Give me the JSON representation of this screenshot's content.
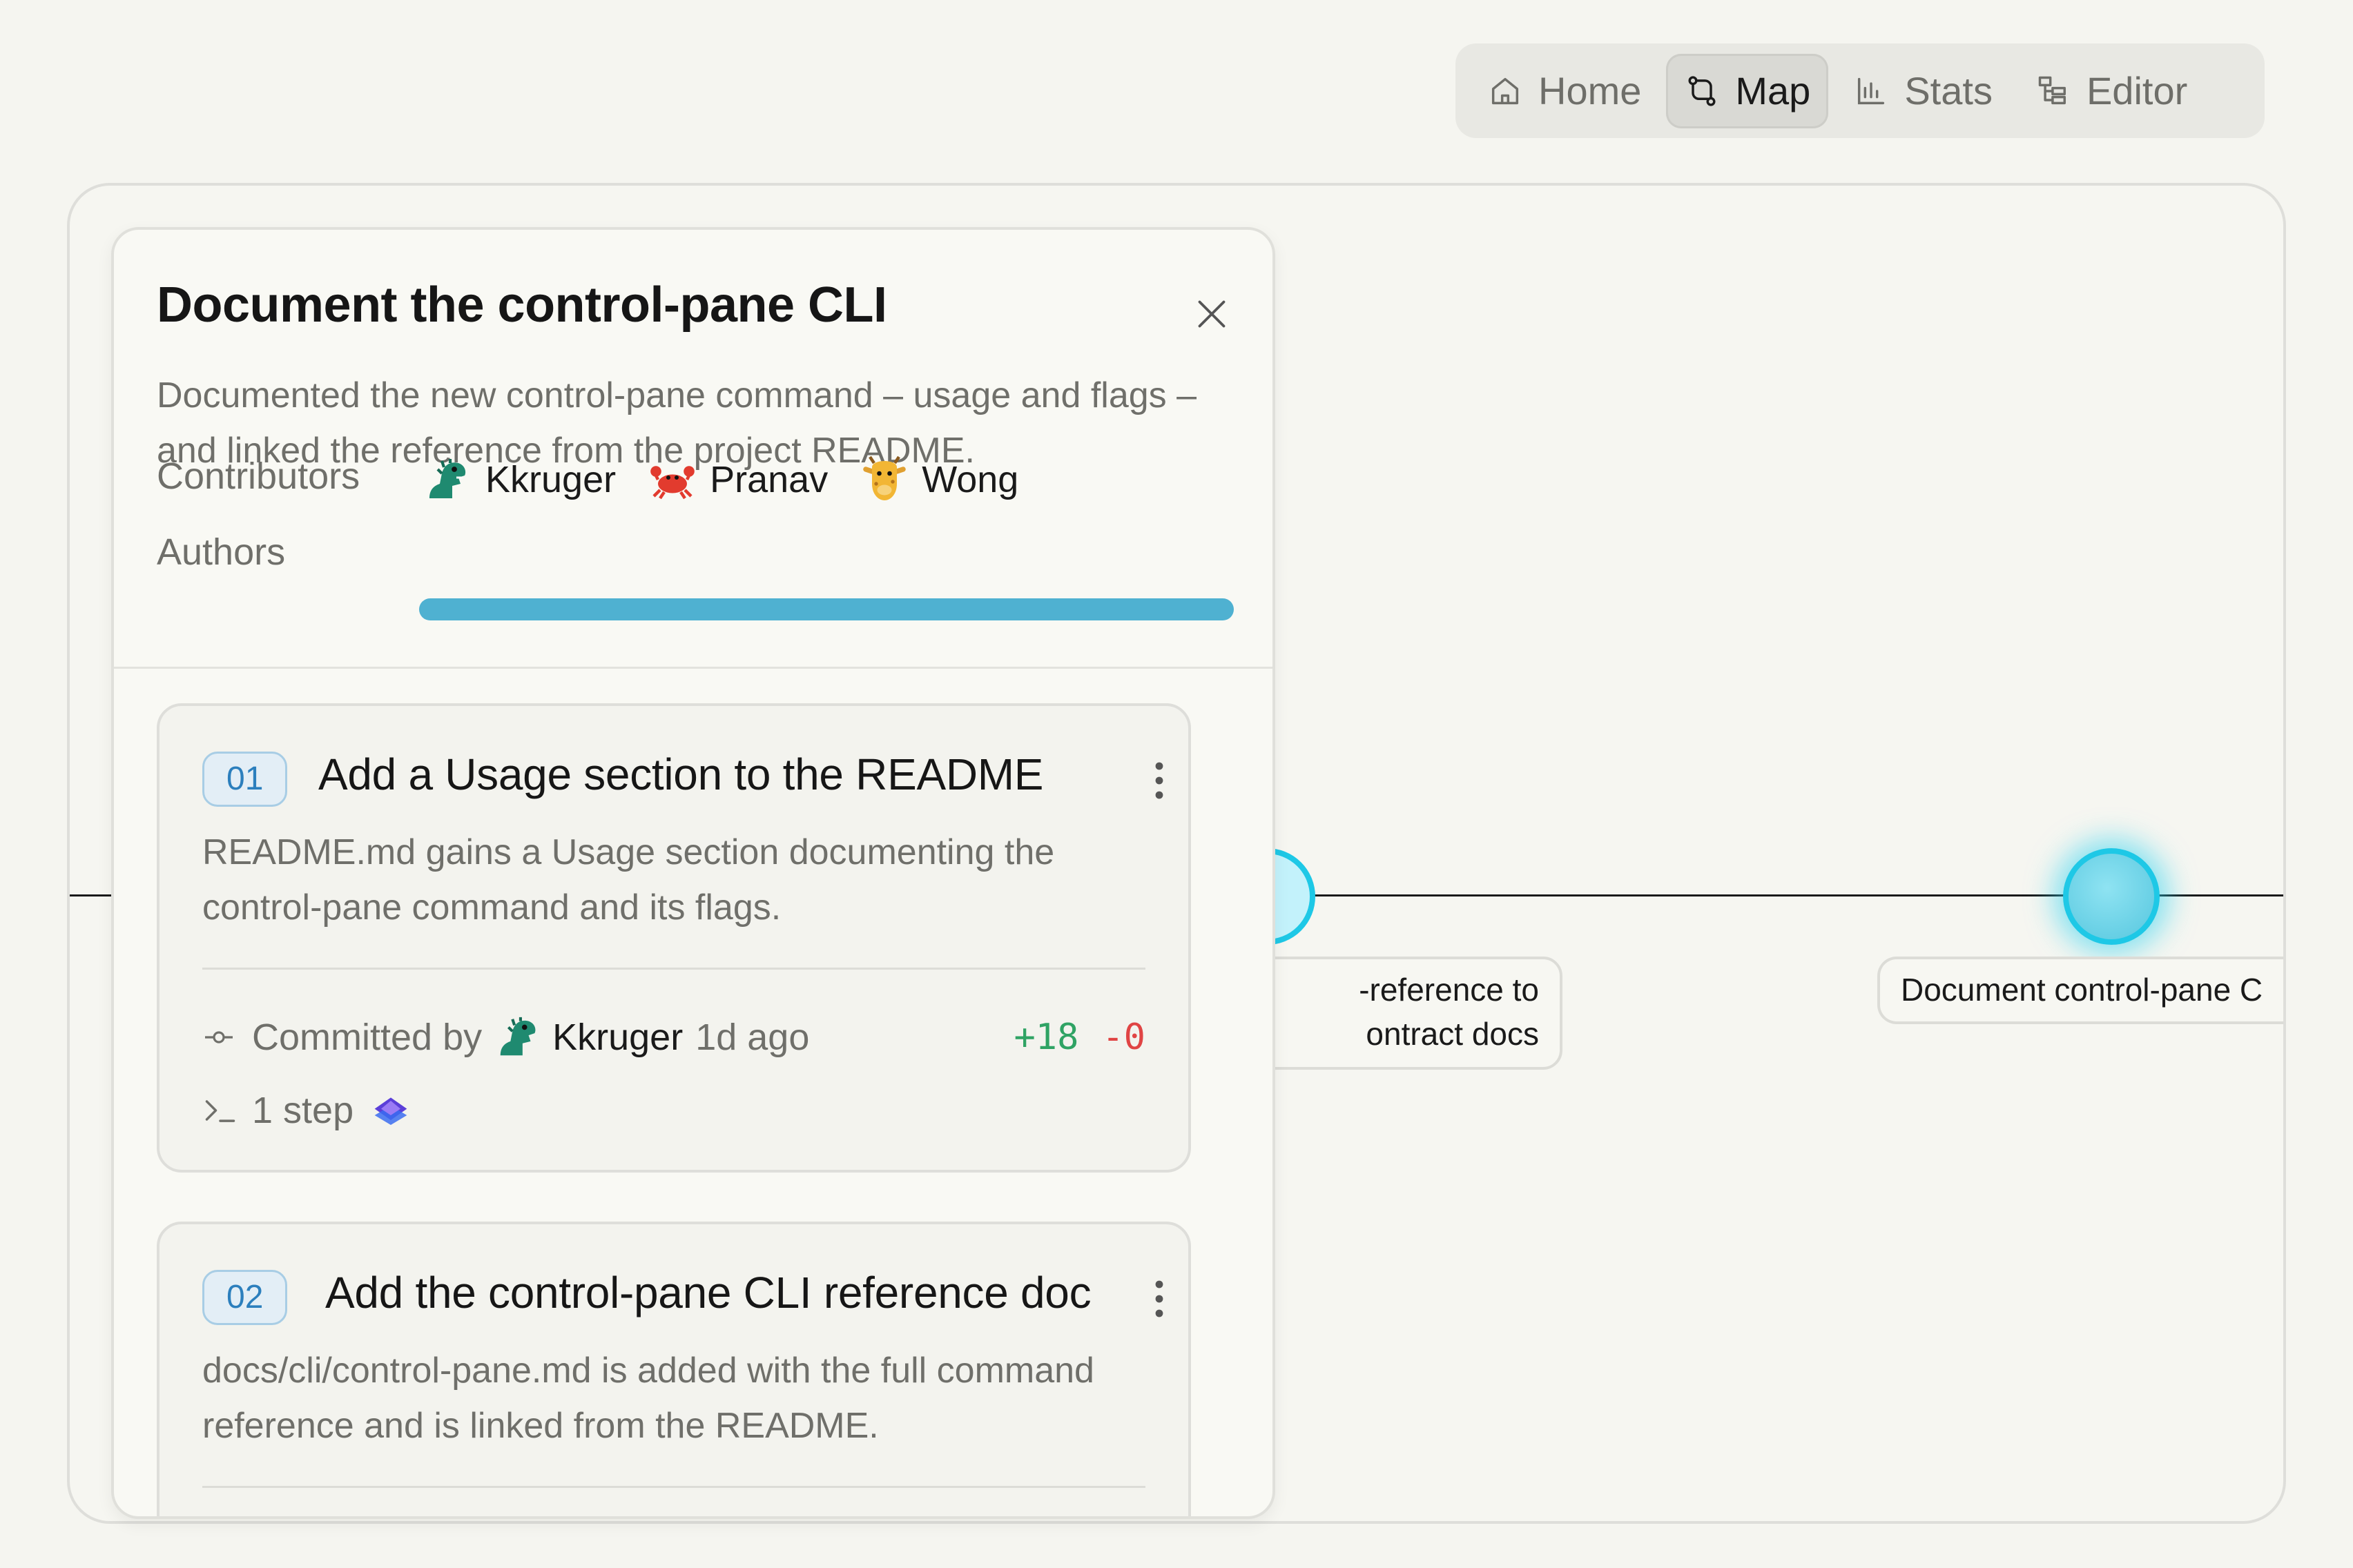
{
  "nav": {
    "items": [
      {
        "label": "Home",
        "icon": "home-icon",
        "active": false
      },
      {
        "label": "Map",
        "icon": "git-branch-icon",
        "active": true
      },
      {
        "label": "Stats",
        "icon": "bar-chart-icon",
        "active": false
      },
      {
        "label": "Editor",
        "icon": "tree-icon",
        "active": false
      }
    ]
  },
  "map": {
    "nodes": [
      {
        "label_line1": "-reference to",
        "label_line2": "ontract docs"
      },
      {
        "label": "Document control-pane C"
      }
    ],
    "accent": "#1ec8e6"
  },
  "panel": {
    "title": "Document the control-pane CLI",
    "description": "Documented the new control-pane command – usage and flags – and linked the reference from the project README.",
    "contributors_label": "Contributors",
    "contributors": [
      {
        "name": "Kkruger",
        "avatar": "dinosaur-icon"
      },
      {
        "name": "Pranav",
        "avatar": "crab-icon"
      },
      {
        "name": "Wong",
        "avatar": "giraffe-icon"
      }
    ],
    "authors_label": "Authors",
    "authors_bar_color": "#4fb1d1",
    "steps": [
      {
        "number": "01",
        "title": "Add a Usage section to the README",
        "description": "README.md gains a Usage section documenting the control-pane command and its flags.",
        "committed_by_label": "Committed by",
        "author": "Kkruger",
        "time": "1d ago",
        "additions": "+18",
        "deletions": "-0",
        "steps_count": "1 step"
      },
      {
        "number": "02",
        "title": "Add the control-pane CLI reference doc",
        "description": "docs/cli/control-pane.md is added with the full command reference and is linked from the README."
      }
    ]
  }
}
